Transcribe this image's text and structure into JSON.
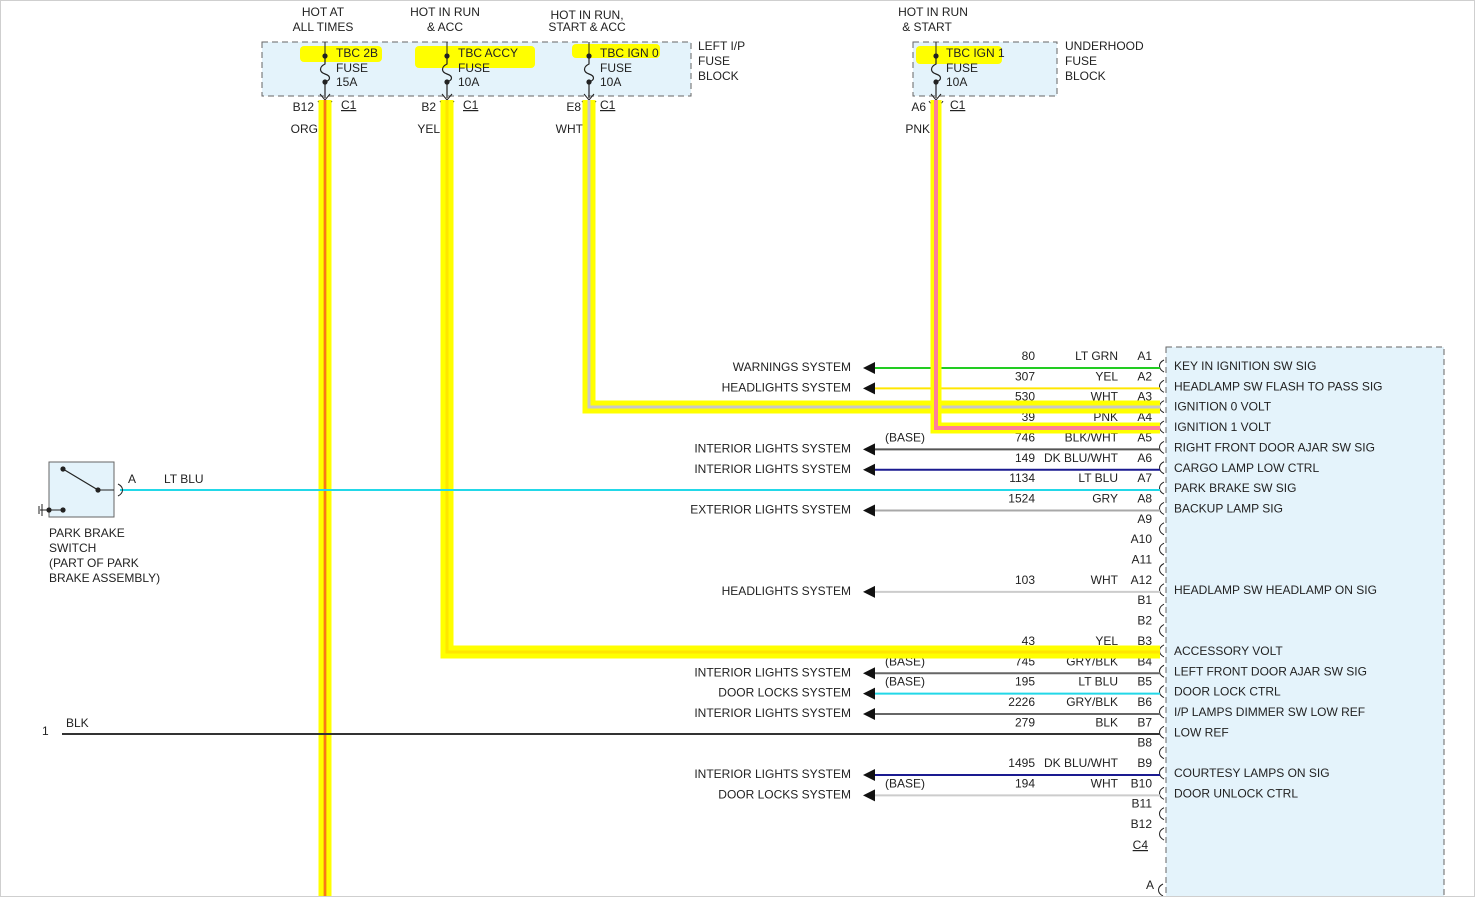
{
  "colors": {
    "highlight": "#ffff00",
    "org_wire": "#f4a000",
    "pink_wire": "#ff7f98",
    "module_fill": "#e4f3fb",
    "lt_grn": "#22cc22",
    "yel": "#ffe600",
    "wht": "#cccccc",
    "pnk": "#ff5a8c",
    "blk_wht": "#555555",
    "dk_blu": "#1a1aa0",
    "lt_blu": "#22d8e8",
    "gry": "#a8a8a8",
    "gry_blk": "#666666",
    "blk": "#333333",
    "dk_blu_wht": "#1a1a90"
  },
  "fuse_blocks": {
    "left": {
      "label": [
        "LEFT I/P",
        "FUSE",
        "BLOCK"
      ]
    },
    "underhood": {
      "label": [
        "UNDERHOOD",
        "FUSE",
        "BLOCK"
      ]
    }
  },
  "fuses": [
    {
      "hot": [
        "HOT AT",
        "ALL TIMES"
      ],
      "name": "TBC 2B",
      "type": "FUSE",
      "amps": "15A",
      "pin": "B12",
      "conn": "C1",
      "wire": "ORG"
    },
    {
      "hot": [
        "HOT IN RUN",
        "& ACC"
      ],
      "name": "TBC ACCY",
      "type": "FUSE",
      "amps": "10A",
      "pin": "B2",
      "conn": "C1",
      "wire": "YEL"
    },
    {
      "hot": [
        "HOT IN RUN,",
        "START & ACC"
      ],
      "name": "TBC IGN 0",
      "type": "FUSE",
      "amps": "10A",
      "pin": "E8",
      "conn": "C1",
      "wire": "WHT"
    },
    {
      "hot": [
        "HOT IN RUN",
        "& START"
      ],
      "name": "TBC IGN 1",
      "type": "FUSE",
      "amps": "10A",
      "pin": "A6",
      "conn": "C1",
      "wire": "PNK"
    }
  ],
  "park_brake": {
    "pin": "A",
    "wire_color": "LT BLU",
    "label": [
      "PARK BRAKE",
      "SWITCH",
      "(PART OF PARK",
      "BRAKE ASSEMBLY)"
    ]
  },
  "ground": {
    "pin": "1",
    "wire_color": "BLK"
  },
  "module_pins": [
    {
      "pin": "A1",
      "circuit": "80",
      "color": "LT GRN",
      "system": "WARNINGS SYSTEM",
      "base": "",
      "signal": "KEY IN IGNITION SW SIG"
    },
    {
      "pin": "A2",
      "circuit": "307",
      "color": "YEL",
      "system": "HEADLIGHTS SYSTEM",
      "base": "",
      "signal": "HEADLAMP SW FLASH TO PASS SIG"
    },
    {
      "pin": "A3",
      "circuit": "530",
      "color": "WHT",
      "system": "",
      "base": "",
      "signal": "IGNITION 0 VOLT"
    },
    {
      "pin": "A4",
      "circuit": "39",
      "color": "PNK",
      "system": "",
      "base": "",
      "signal": "IGNITION 1 VOLT"
    },
    {
      "pin": "A5",
      "circuit": "746",
      "color": "BLK/WHT",
      "system": "INTERIOR LIGHTS SYSTEM",
      "base": "(BASE)",
      "signal": "RIGHT FRONT DOOR AJAR SW SIG"
    },
    {
      "pin": "A6",
      "circuit": "149",
      "color": "DK BLU/WHT",
      "system": "INTERIOR LIGHTS SYSTEM",
      "base": "",
      "signal": "CARGO LAMP LOW CTRL"
    },
    {
      "pin": "A7",
      "circuit": "1134",
      "color": "LT BLU",
      "system": "",
      "base": "",
      "signal": "PARK BRAKE SW SIG"
    },
    {
      "pin": "A8",
      "circuit": "1524",
      "color": "GRY",
      "system": "EXTERIOR LIGHTS SYSTEM",
      "base": "",
      "signal": "BACKUP LAMP SIG"
    },
    {
      "pin": "A9",
      "circuit": "",
      "color": "",
      "system": "",
      "base": "",
      "signal": ""
    },
    {
      "pin": "A10",
      "circuit": "",
      "color": "",
      "system": "",
      "base": "",
      "signal": ""
    },
    {
      "pin": "A11",
      "circuit": "",
      "color": "",
      "system": "",
      "base": "",
      "signal": ""
    },
    {
      "pin": "A12",
      "circuit": "103",
      "color": "WHT",
      "system": "HEADLIGHTS SYSTEM",
      "base": "",
      "signal": "HEADLAMP SW HEADLAMP ON SIG"
    },
    {
      "pin": "B1",
      "circuit": "",
      "color": "",
      "system": "",
      "base": "",
      "signal": ""
    },
    {
      "pin": "B2",
      "circuit": "",
      "color": "",
      "system": "",
      "base": "",
      "signal": ""
    },
    {
      "pin": "B3",
      "circuit": "43",
      "color": "YEL",
      "system": "",
      "base": "",
      "signal": "ACCESSORY VOLT"
    },
    {
      "pin": "B4",
      "circuit": "745",
      "color": "GRY/BLK",
      "system": "INTERIOR LIGHTS SYSTEM",
      "base": "(BASE)",
      "signal": "LEFT FRONT DOOR AJAR SW SIG"
    },
    {
      "pin": "B5",
      "circuit": "195",
      "color": "LT BLU",
      "system": "DOOR LOCKS SYSTEM",
      "base": "(BASE)",
      "signal": "DOOR LOCK CTRL"
    },
    {
      "pin": "B6",
      "circuit": "2226",
      "color": "GRY/BLK",
      "system": "INTERIOR LIGHTS SYSTEM",
      "base": "",
      "signal": "I/P LAMPS DIMMER SW LOW REF"
    },
    {
      "pin": "B7",
      "circuit": "279",
      "color": "BLK",
      "system": "",
      "base": "",
      "signal": "LOW REF"
    },
    {
      "pin": "B8",
      "circuit": "",
      "color": "",
      "system": "",
      "base": "",
      "signal": ""
    },
    {
      "pin": "B9",
      "circuit": "1495",
      "color": "DK BLU/WHT",
      "system": "INTERIOR LIGHTS SYSTEM",
      "base": "",
      "signal": "COURTESY LAMPS ON SIG"
    },
    {
      "pin": "B10",
      "circuit": "194",
      "color": "WHT",
      "system": "DOOR LOCKS SYSTEM",
      "base": "(BASE)",
      "signal": "DOOR UNLOCK CTRL"
    },
    {
      "pin": "B11",
      "circuit": "",
      "color": "",
      "system": "",
      "base": "",
      "signal": ""
    },
    {
      "pin": "B12",
      "circuit": "",
      "color": "",
      "system": "",
      "base": "",
      "signal": ""
    }
  ],
  "module_connector": "C4",
  "module_bottom_pin": "A"
}
